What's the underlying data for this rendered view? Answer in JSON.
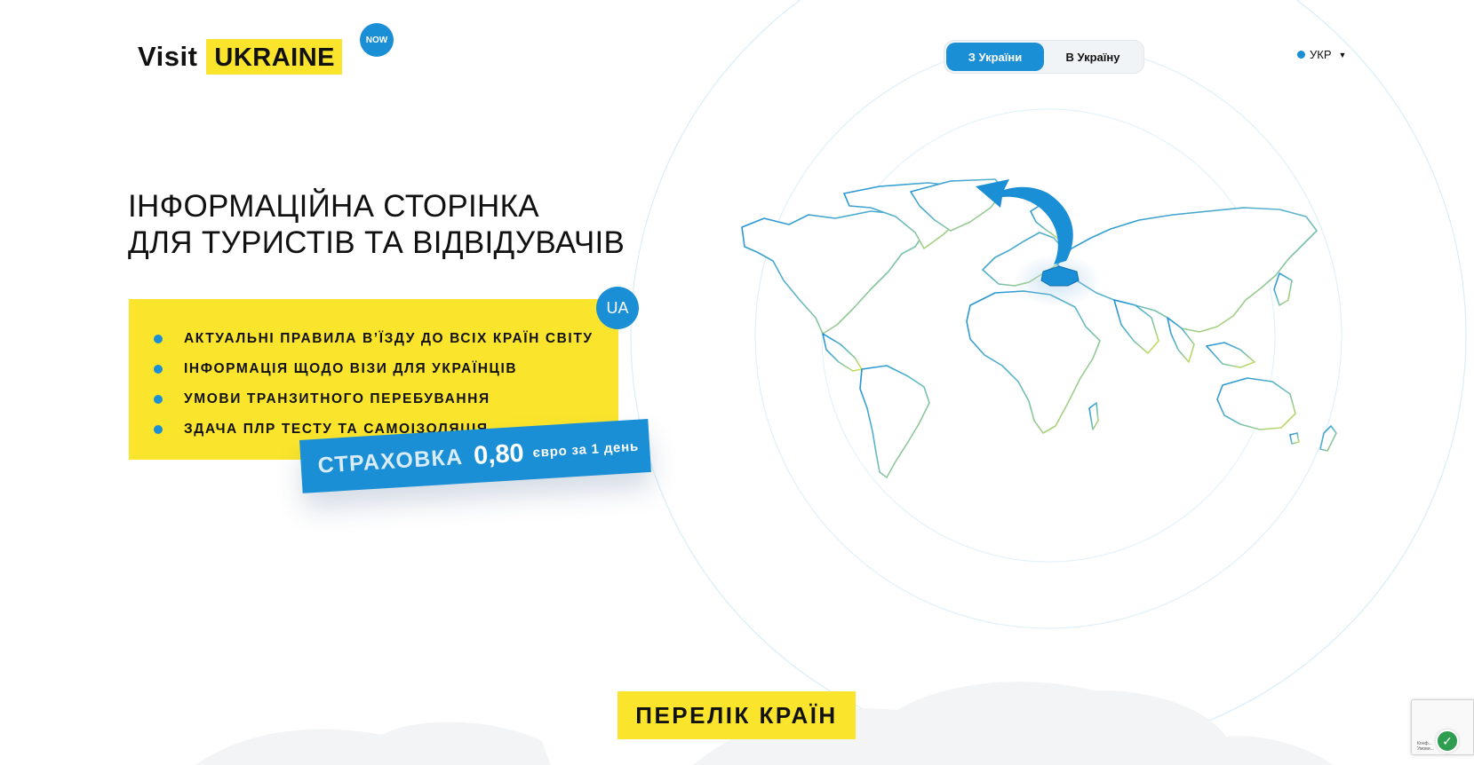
{
  "header": {
    "logo": {
      "visit": "Visit",
      "ukraine": "UKRAINE",
      "now": "NOW"
    },
    "toggle": {
      "from_ukraine": "З України",
      "to_ukraine": "В Україну",
      "active": "from_ukraine"
    },
    "language": {
      "label": "УКР"
    }
  },
  "hero": {
    "headline_line1": "ІНФОРМАЦІЙНА СТОРІНКА",
    "headline_line2": "ДЛЯ ТУРИСТІВ ТА ВІДВІДУВАЧІВ",
    "badge": "UA",
    "features": [
      {
        "label": "АКТУАЛЬНІ ПРАВИЛА В’ЇЗДУ ДО ВСІХ КРАЇН СВІТУ"
      },
      {
        "label": "ІНФОРМАЦІЯ ЩОДО ВІЗИ ДЛЯ УКРАЇНЦІВ"
      },
      {
        "label": "УМОВИ ТРАНЗИТНОГО ПЕРЕБУВАННЯ"
      },
      {
        "label": "ЗДАЧА ПЛР ТЕСТУ ТА САМОІЗОЛЯЦІЯ"
      }
    ],
    "insurance": {
      "label": "СТРАХОВКА",
      "price": "0,80",
      "unit": "євро за 1 день"
    }
  },
  "countries": {
    "button_label": "ПЕРЕЛІК КРАЇН"
  },
  "recaptcha": {
    "text_line1": "Конф...",
    "text_line2": "Умови..."
  },
  "colors": {
    "accent_blue": "#1b8fd6",
    "accent_yellow": "#fbe52c",
    "text": "#111111"
  },
  "icons": [
    "bullet-dot-icon",
    "caret-down-icon",
    "curved-arrow-icon",
    "world-map-icon",
    "shield-check-icon"
  ]
}
